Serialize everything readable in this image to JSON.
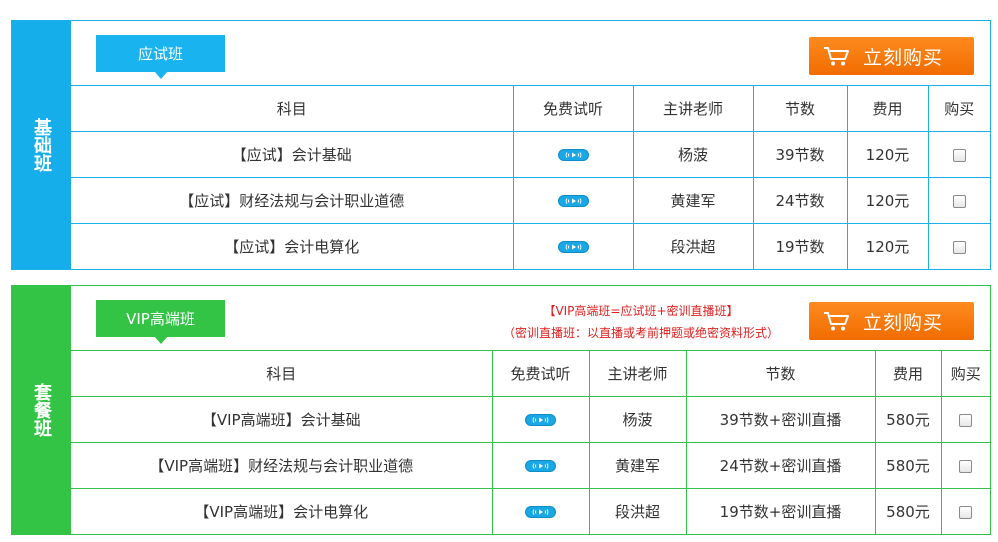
{
  "basic": {
    "side_label": "基础班",
    "tag": "应试班",
    "buy_button": "立刻购买",
    "headers": [
      "科目",
      "免费试听",
      "主讲老师",
      "节数",
      "费用",
      "购买"
    ],
    "rows": [
      {
        "subject": "【应试】会计基础",
        "teacher": "杨菠",
        "lessons": "39节数",
        "price": "120元"
      },
      {
        "subject": "【应试】财经法规与会计职业道德",
        "teacher": "黄建军",
        "lessons": "24节数",
        "price": "120元"
      },
      {
        "subject": "【应试】会计电算化",
        "teacher": "段洪超",
        "lessons": "19节数",
        "price": "120元"
      }
    ]
  },
  "package": {
    "side_label": "套餐班",
    "tag": "VIP高端班",
    "buy_button": "立刻购买",
    "notice_line1": "【VIP高端班=应试班+密训直播班】",
    "notice_line2": "（密训直播班：以直播或考前押题或绝密资料形式）",
    "headers": [
      "科目",
      "免费试听",
      "主讲老师",
      "节数",
      "费用",
      "购买"
    ],
    "rows": [
      {
        "subject": "【VIP高端班】会计基础",
        "teacher": "杨菠",
        "lessons": "39节数+密训直播",
        "price": "580元"
      },
      {
        "subject": "【VIP高端班】财经法规与会计职业道德",
        "teacher": "黄建军",
        "lessons": "24节数+密训直播",
        "price": "580元"
      },
      {
        "subject": "【VIP高端班】会计电算化",
        "teacher": "段洪超",
        "lessons": "19节数+密训直播",
        "price": "580元"
      }
    ]
  },
  "colors": {
    "blue": "#16aeea",
    "green": "#33c446",
    "orange": "#f57a0f",
    "notice_red": "#e02020"
  },
  "icons": {
    "cart": "shopping-cart-icon",
    "play": "audio-play-icon",
    "checkbox": "checkbox"
  }
}
